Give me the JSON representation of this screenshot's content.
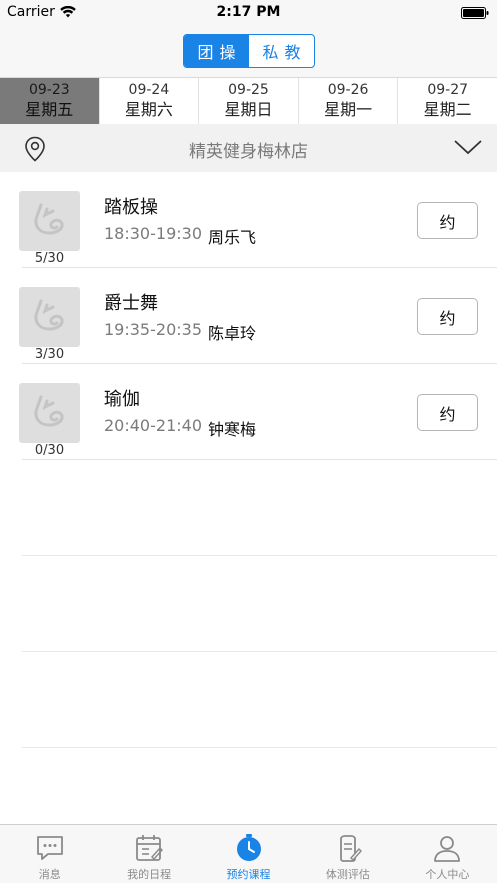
{
  "status_bar": {
    "carrier": "Carrier",
    "time": "2:17 PM"
  },
  "nav": {
    "segments": [
      {
        "label": "团操",
        "active": true
      },
      {
        "label": "私教",
        "active": false
      }
    ],
    "accent_color": "#1a83e6"
  },
  "dates": [
    {
      "date": "09-23",
      "weekday": "星期五",
      "selected": true
    },
    {
      "date": "09-24",
      "weekday": "星期六",
      "selected": false
    },
    {
      "date": "09-25",
      "weekday": "星期日",
      "selected": false
    },
    {
      "date": "09-26",
      "weekday": "星期一",
      "selected": false
    },
    {
      "date": "09-27",
      "weekday": "星期二",
      "selected": false
    }
  ],
  "location": {
    "store_name": "精英健身梅林店",
    "icon": "location-pin-icon",
    "dropdown_icon": "chevron-down-icon"
  },
  "courses": [
    {
      "name": "踏板操",
      "time": "18:30-19:30",
      "coach": "周乐飞",
      "capacity": "5/30",
      "button": "约"
    },
    {
      "name": "爵士舞",
      "time": "19:35-20:35",
      "coach": "陈卓玲",
      "capacity": "3/30",
      "button": "约"
    },
    {
      "name": "瑜伽",
      "time": "20:40-21:40",
      "coach": "钟寒梅",
      "capacity": "0/30",
      "button": "约"
    }
  ],
  "tabs": [
    {
      "label": "消息",
      "icon": "message-icon",
      "active": false
    },
    {
      "label": "我的日程",
      "icon": "calendar-icon",
      "active": false
    },
    {
      "label": "预约课程",
      "icon": "clock-icon",
      "active": true
    },
    {
      "label": "体测评估",
      "icon": "fitness-test-icon",
      "active": false
    },
    {
      "label": "个人中心",
      "icon": "person-icon",
      "active": false
    }
  ]
}
